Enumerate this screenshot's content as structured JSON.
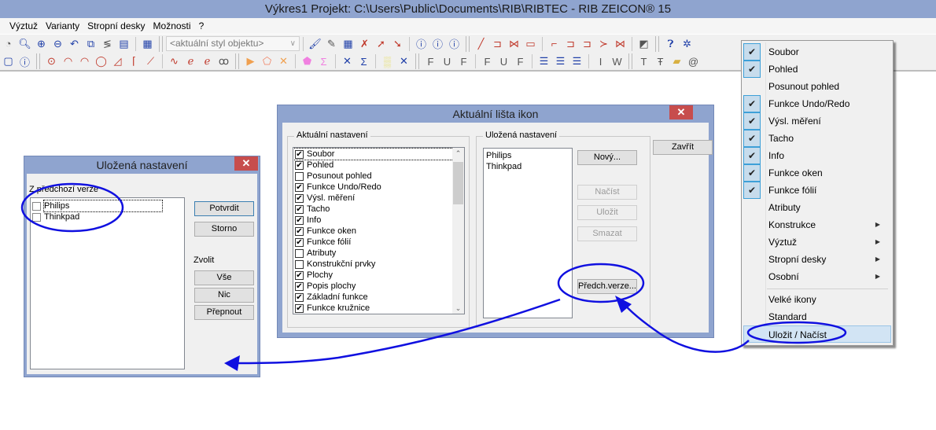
{
  "window": {
    "title": "Výkres1  Projekt: C:\\Users\\Public\\Documents\\RIB\\RIBTEC  -  RIB ZEICON® 15"
  },
  "menubar": {
    "items": [
      "Výztuž",
      "Varianty",
      "Stropní desky",
      "Možnosti",
      "?"
    ]
  },
  "toolbar": {
    "style_combo": "<aktuální styl objektu>",
    "row1_icons": [
      "pan-icon",
      "zoom-icon",
      "zoom-in-icon",
      "zoom-out-icon",
      "zoom-previous-icon",
      "zoom-window-icon",
      "redraw-icon",
      "frame-icon",
      "layout-icon",
      "paint-brush-icon",
      "style-pick-icon",
      "attribute-find-icon",
      "attribute-delete-icon",
      "attribute-transfer-icon",
      "attribute-copy-icon",
      "info-pick-icon",
      "info-edit-icon",
      "info-text-icon",
      "line-icon",
      "polyline-icon",
      "polyline-closed-icon",
      "rectangle-icon",
      "edit-corner-icon",
      "edit-insert-icon",
      "edit-extend-icon",
      "edit-break-icon",
      "edit-trim-icon",
      "fill-icon",
      "help-icon",
      "rib-logo-icon"
    ],
    "row2_icons": [
      "window-icon",
      "info-icon",
      "circle-icon",
      "arc-icon",
      "arc-3pt-icon",
      "arc-tangent-icon",
      "triangle-icon",
      "tangent-line-icon",
      "tangent-arc-icon",
      "spline-icon",
      "curve-icon",
      "curve-2-icon",
      "curve-3-icon",
      "point-icon",
      "area-icon",
      "area-delete-icon",
      "hatch-icon",
      "hatch-sum-icon",
      "cross-icon",
      "cross-sum-icon",
      "pattern-icon",
      "pattern-delete-icon",
      "text-f-icon",
      "text-u-icon",
      "text-fu-icon",
      "text-f2-icon",
      "text-u2-icon",
      "text-fu2-icon",
      "table-f-icon",
      "table-u-icon",
      "table-fu-icon",
      "text-i-icon",
      "text-w-icon",
      "text-t-icon",
      "text-tt-icon",
      "folder-text-icon",
      "at-icon"
    ]
  },
  "icon_bar_dialog": {
    "title": "Aktuální lišta ikon",
    "close_label": "✕",
    "current_group_label": "Aktuální nastavení",
    "current_items": [
      {
        "label": "Soubor",
        "checked": true
      },
      {
        "label": "Pohled",
        "checked": true
      },
      {
        "label": "Posunout pohled",
        "checked": false
      },
      {
        "label": "Funkce Undo/Redo",
        "checked": true
      },
      {
        "label": "Výsl. měření",
        "checked": true
      },
      {
        "label": "Tacho",
        "checked": true
      },
      {
        "label": "Info",
        "checked": true
      },
      {
        "label": "Funkce oken",
        "checked": true
      },
      {
        "label": "Funkce fólií",
        "checked": true
      },
      {
        "label": "Atributy",
        "checked": false
      },
      {
        "label": "Konstrukční prvky",
        "checked": false
      },
      {
        "label": "Plochy",
        "checked": true
      },
      {
        "label": "Popis plochy",
        "checked": true
      },
      {
        "label": "Základní funkce",
        "checked": true
      },
      {
        "label": "Funkce kružnice",
        "checked": true
      }
    ],
    "saved_group_label": "Uložená nastavení",
    "saved_items": [
      "Philips",
      "Thinkpad"
    ],
    "buttons": {
      "new": "Nový...",
      "load": "Načíst",
      "save": "Uložit",
      "delete": "Smazat",
      "previous_version": "Předch.verze...",
      "close": "Zavřít"
    }
  },
  "saved_settings_dialog": {
    "title": "Uložená nastavení",
    "close_label": "✕",
    "list_label": "Z předchozí verze",
    "items": [
      {
        "label": "Philips",
        "checked": false
      },
      {
        "label": "Thinkpad",
        "checked": false
      }
    ],
    "buttons": {
      "confirm": "Potvrdit",
      "cancel": "Storno",
      "select_label": "Zvolit",
      "all": "Vše",
      "none": "Nic",
      "toggle": "Přepnout"
    }
  },
  "context_menu": {
    "items": [
      {
        "label": "Soubor",
        "checked": true
      },
      {
        "label": "Pohled",
        "checked": true
      },
      {
        "label": "Posunout pohled",
        "checked": false
      },
      {
        "label": "Funkce Undo/Redo",
        "checked": true
      },
      {
        "label": "Výsl. měření",
        "checked": true
      },
      {
        "label": "Tacho",
        "checked": true
      },
      {
        "label": "Info",
        "checked": true
      },
      {
        "label": "Funkce oken",
        "checked": true
      },
      {
        "label": "Funkce fólií",
        "checked": true
      },
      {
        "label": "Atributy",
        "checked": false
      },
      {
        "label": "Konstrukce",
        "submenu": true
      },
      {
        "label": "Výztuž",
        "submenu": true
      },
      {
        "label": "Stropní desky",
        "submenu": true
      },
      {
        "label": "Osobní",
        "submenu": true
      }
    ],
    "bottom_items": [
      "Velké ikony",
      "Standard",
      "Uložit / Načíst"
    ],
    "highlighted": "Uložit / Načíst"
  },
  "colors": {
    "titlebar": "#8fa4cf",
    "close_button": "#c74d4d",
    "annotation": "#1010e0",
    "menu_check_bg": "#c7dcec"
  }
}
